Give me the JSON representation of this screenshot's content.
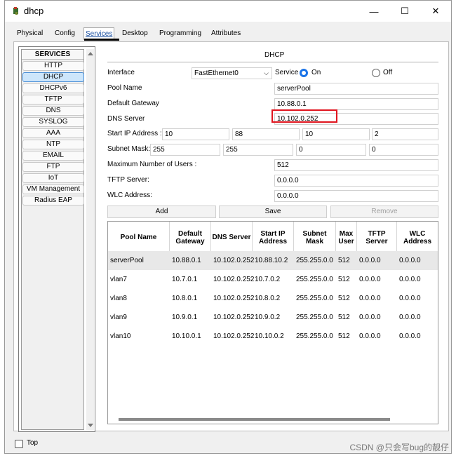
{
  "window": {
    "title": "dhcp",
    "controls": {
      "minimize": "—",
      "maximize": "☐",
      "close": "✕"
    }
  },
  "tabs": [
    "Physical",
    "Config",
    "Services",
    "Desktop",
    "Programming",
    "Attributes"
  ],
  "active_tab": "Services",
  "services": {
    "header": "SERVICES",
    "items": [
      "HTTP",
      "DHCP",
      "DHCPv6",
      "TFTP",
      "DNS",
      "SYSLOG",
      "AAA",
      "NTP",
      "EMAIL",
      "FTP",
      "IoT",
      "VM Management",
      "Radius EAP"
    ],
    "selected": "DHCP"
  },
  "dhcp": {
    "title": "DHCP",
    "interface_label": "Interface",
    "interface_value": "FastEthernet0",
    "service_label": "Service",
    "on_label": "On",
    "off_label": "Off",
    "service_state": "On",
    "pool_name_label": "Pool Name",
    "pool_name": "serverPool",
    "gateway_label": "Default Gateway",
    "gateway": "10.88.0.1",
    "dns_label": "DNS Server",
    "dns": "10.102.0.252",
    "start_ip_label": "Start IP Address :",
    "start_ip": [
      "10",
      "88",
      "10",
      "2"
    ],
    "mask_label": "Subnet Mask:",
    "mask": [
      "255",
      "255",
      "0",
      "0"
    ],
    "max_users_label": "Maximum Number of Users :",
    "max_users": "512",
    "tftp_label": "TFTP Server:",
    "tftp": "0.0.0.0",
    "wlc_label": "WLC Address:",
    "wlc": "0.0.0.0",
    "buttons": {
      "add": "Add",
      "save": "Save",
      "remove": "Remove"
    }
  },
  "table": {
    "headers": [
      "Pool Name",
      "Default Gateway",
      "DNS Server",
      "Start IP Address",
      "Subnet Mask",
      "Max User",
      "TFTP Server",
      "WLC Address"
    ],
    "rows": [
      [
        "serverPool",
        "10.88.0.1",
        "10.102.0.252",
        "10.88.10.2",
        "255.255.0.0",
        "512",
        "0.0.0.0",
        "0.0.0.0"
      ],
      [
        "vlan7",
        "10.7.0.1",
        "10.102.0.252",
        "10.7.0.2",
        "255.255.0.0",
        "512",
        "0.0.0.0",
        "0.0.0.0"
      ],
      [
        "vlan8",
        "10.8.0.1",
        "10.102.0.252",
        "10.8.0.2",
        "255.255.0.0",
        "512",
        "0.0.0.0",
        "0.0.0.0"
      ],
      [
        "vlan9",
        "10.9.0.1",
        "10.102.0.252",
        "10.9.0.2",
        "255.255.0.0",
        "512",
        "0.0.0.0",
        "0.0.0.0"
      ],
      [
        "vlan10",
        "10.10.0.1",
        "10.102.0.252",
        "10.10.0.2",
        "255.255.0.0",
        "512",
        "0.0.0.0",
        "0.0.0.0"
      ]
    ]
  },
  "footer": {
    "top_label": "Top",
    "watermark": "CSDN @只会写bug的靓仔"
  },
  "colors": {
    "accent": "#1a73e8",
    "highlight": "#e0141e",
    "selected_service": "#cde6fb"
  }
}
